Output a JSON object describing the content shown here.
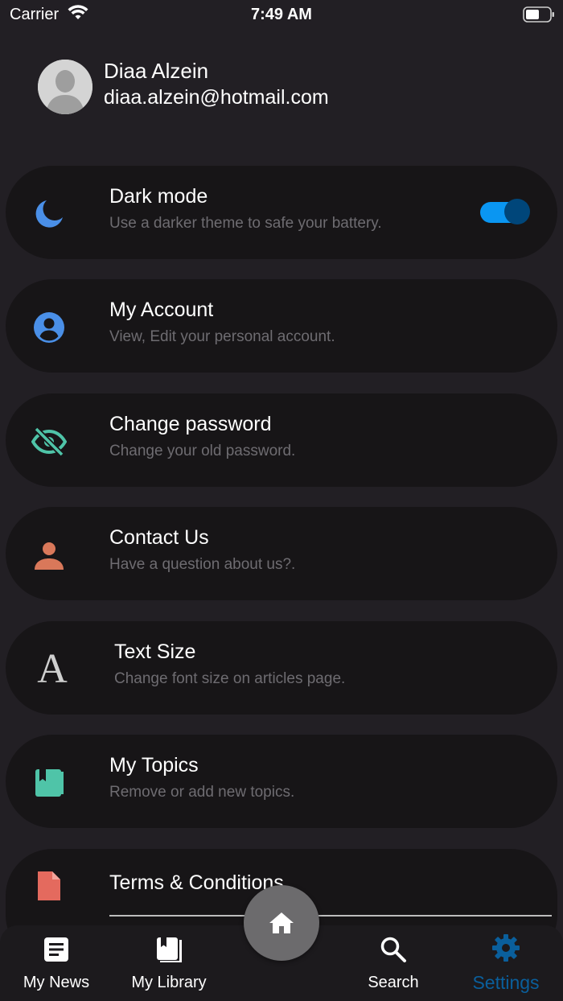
{
  "status_bar": {
    "carrier": "Carrier",
    "time": "7:49 AM"
  },
  "profile": {
    "name": "Diaa Alzein",
    "email": "diaa.alzein@hotmail.com"
  },
  "settings": {
    "dark_mode": {
      "title": "Dark mode",
      "subtitle": "Use a darker theme to safe your battery.",
      "icon": "moon-icon",
      "icon_color": "#4a8fe7",
      "enabled": true
    },
    "my_account": {
      "title": "My Account",
      "subtitle": "View, Edit your personal account.",
      "icon": "account-circle-icon",
      "icon_color": "#4a8fe7"
    },
    "change_password": {
      "title": "Change password",
      "subtitle": "Change your old password.",
      "icon": "eye-off-icon",
      "icon_color": "#4fc4a8"
    },
    "contact_us": {
      "title": "Contact Us",
      "subtitle": "Have a question about us?.",
      "icon": "person-icon",
      "icon_color": "#d9785a"
    },
    "text_size": {
      "title": "Text Size",
      "subtitle": "Change font size on articles page.",
      "icon": "text-size-icon",
      "glyph": "A"
    },
    "my_topics": {
      "title": "My Topics",
      "subtitle": "Remove or add new topics.",
      "icon": "bookmark-book-icon",
      "icon_color": "#4fc4a8"
    },
    "terms": {
      "title": "Terms & Conditions",
      "icon": "document-icon",
      "icon_color": "#e46a5e"
    }
  },
  "bottom_nav": {
    "items": [
      {
        "label": "My News",
        "icon": "news-icon",
        "active": false
      },
      {
        "label": "My Library",
        "icon": "library-icon",
        "active": false
      },
      {
        "label": "Search",
        "icon": "search-icon",
        "active": false
      },
      {
        "label": "Settings",
        "icon": "gear-icon",
        "active": true
      }
    ],
    "home_icon": "home-icon",
    "active_color": "#0a5f9c"
  }
}
